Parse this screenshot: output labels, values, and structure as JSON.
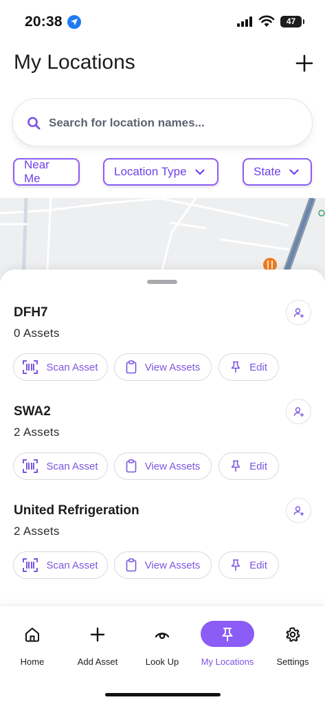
{
  "status_bar": {
    "time": "20:38",
    "battery": "47"
  },
  "header": {
    "title": "My Locations",
    "add_icon": "plus-icon"
  },
  "search": {
    "placeholder": "Search for location names...",
    "value": ""
  },
  "filters": {
    "near_me": "Near Me",
    "location_type": "Location Type",
    "state": "State"
  },
  "locations": [
    {
      "name": "DFH7",
      "count": "0 Assets"
    },
    {
      "name": "SWA2",
      "count": "2 Assets"
    },
    {
      "name": "United Refrigeration",
      "count": "2 Assets"
    }
  ],
  "actions": {
    "scan": "Scan Asset",
    "view": "View Assets",
    "edit": "Edit"
  },
  "tabs": [
    {
      "label": "Home",
      "icon": "home-icon"
    },
    {
      "label": "Add Asset",
      "icon": "plus-icon"
    },
    {
      "label": "Look Up",
      "icon": "eye-icon"
    },
    {
      "label": "My Locations",
      "icon": "pin-icon",
      "active": true
    },
    {
      "label": "Settings",
      "icon": "gear-icon"
    }
  ],
  "colors": {
    "accent": "#8b5cf6",
    "accent_text": "#6e42e8"
  }
}
